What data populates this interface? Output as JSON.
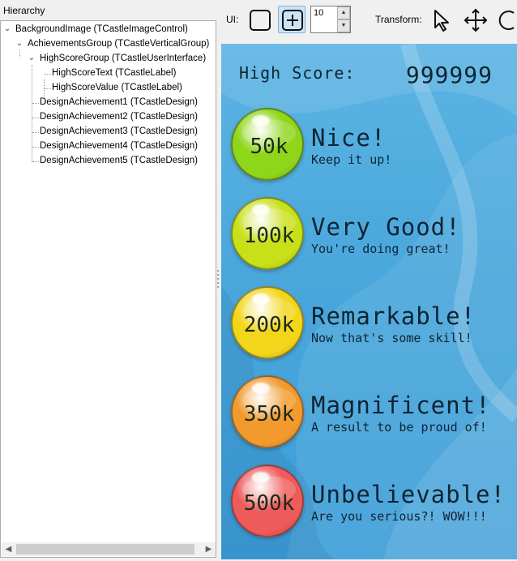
{
  "hierarchy": {
    "title": "Hierarchy",
    "items": [
      {
        "label": "BackgroundImage (TCastleImageControl)"
      },
      {
        "label": "AchievementsGroup (TCastleVerticalGroup)"
      },
      {
        "label": "HighScoreGroup (TCastleUserInterface)"
      },
      {
        "label": "HighScoreText (TCastleLabel)"
      },
      {
        "label": "HighScoreValue (TCastleLabel)"
      },
      {
        "label": "DesignAchievement1 (TCastleDesign)"
      },
      {
        "label": "DesignAchievement2 (TCastleDesign)"
      },
      {
        "label": "DesignAchievement3 (TCastleDesign)"
      },
      {
        "label": "DesignAchievement4 (TCastleDesign)"
      },
      {
        "label": "DesignAchievement5 (TCastleDesign)"
      }
    ]
  },
  "toolbar": {
    "ui_label": "UI:",
    "spin_value": "10",
    "transform_label": "Transform:",
    "tools": [
      "select-arrow-icon",
      "move-icon",
      "rotate-icon"
    ]
  },
  "game": {
    "high_score_text": "High Score:",
    "high_score_value": "999999",
    "achievements": [
      {
        "threshold": "50k",
        "title": "Nice!",
        "subtitle": "Keep it up!",
        "color": "#8fd61a"
      },
      {
        "threshold": "100k",
        "title": "Very Good!",
        "subtitle": "You're doing great!",
        "color": "#c8e01a"
      },
      {
        "threshold": "200k",
        "title": "Remarkable!",
        "subtitle": "Now that's some skill!",
        "color": "#f3d51a"
      },
      {
        "threshold": "350k",
        "title": "Magnificent!",
        "subtitle": "A result to be proud of!",
        "color": "#f29a2e"
      },
      {
        "threshold": "500k",
        "title": "Unbelievable!",
        "subtitle": "Are you serious?! WOW!!!",
        "color": "#ef5a5a"
      }
    ]
  }
}
